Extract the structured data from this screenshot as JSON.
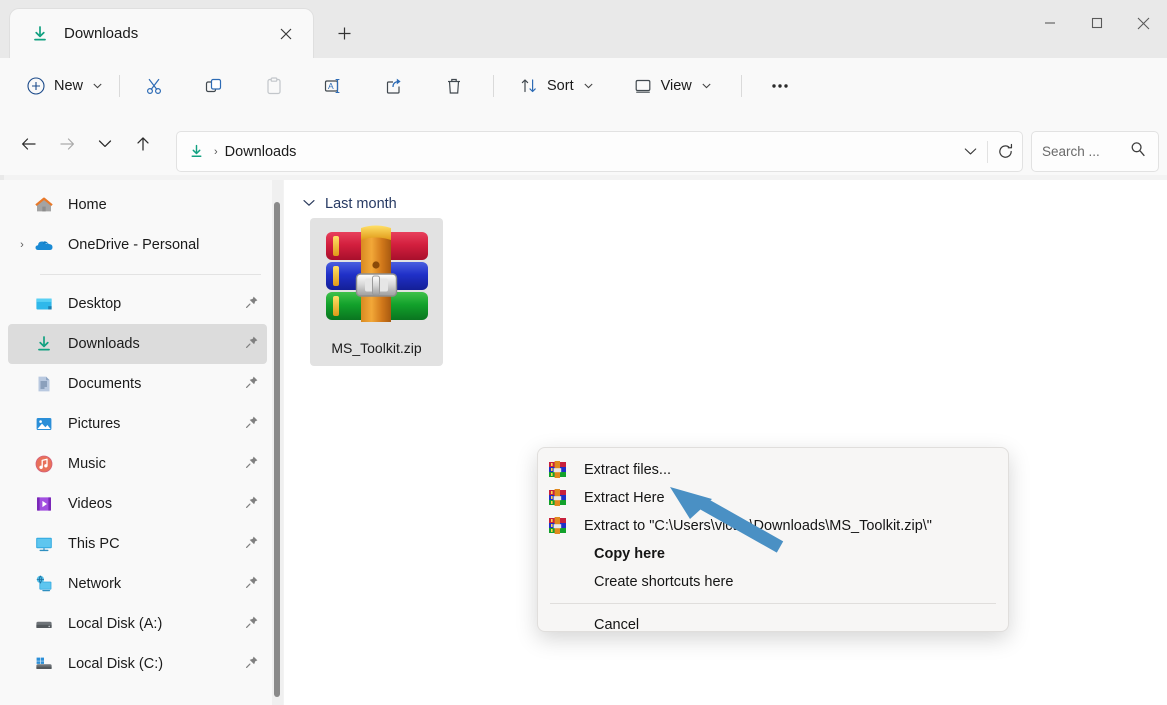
{
  "window": {
    "controls": {
      "minimize": "—",
      "maximize": "□",
      "close": "✕"
    }
  },
  "tab": {
    "title": "Downloads",
    "icon": "downloads-icon",
    "close_label": "✕",
    "new_tab_label": "+"
  },
  "toolbar": {
    "new_label": "New",
    "new_chevron": "⌄",
    "cut_label": "Cut",
    "copy_label": "Copy",
    "paste_label": "Paste",
    "rename_label": "Rename",
    "share_label": "Share",
    "delete_label": "Delete",
    "sort_label": "Sort",
    "sort_chevron": "⌄",
    "view_label": "View",
    "view_chevron": "⌄",
    "more_label": "•••"
  },
  "addressbar": {
    "back_label": "←",
    "forward_label": "→",
    "recent_label": "⌄",
    "up_label": "↑",
    "path_icon": "downloads-icon",
    "separator": "›",
    "crumb": "Downloads",
    "dropdown_label": "⌄",
    "refresh_label": "↻"
  },
  "search": {
    "placeholder": "Search ...",
    "icon": "search-icon"
  },
  "sidebar": {
    "items": [
      {
        "label": "Home",
        "icon": "home-icon",
        "expander": "",
        "pinned": false,
        "selected": false
      },
      {
        "label": "OneDrive - Personal",
        "icon": "onedrive-icon",
        "expander": "›",
        "pinned": false,
        "selected": false
      },
      {
        "label": "Desktop",
        "icon": "desktop-icon",
        "expander": "",
        "pinned": true,
        "selected": false
      },
      {
        "label": "Downloads",
        "icon": "downloads-icon",
        "expander": "",
        "pinned": true,
        "selected": true
      },
      {
        "label": "Documents",
        "icon": "documents-icon",
        "expander": "",
        "pinned": true,
        "selected": false
      },
      {
        "label": "Pictures",
        "icon": "pictures-icon",
        "expander": "",
        "pinned": true,
        "selected": false
      },
      {
        "label": "Music",
        "icon": "music-icon",
        "expander": "",
        "pinned": true,
        "selected": false
      },
      {
        "label": "Videos",
        "icon": "videos-icon",
        "expander": "",
        "pinned": true,
        "selected": false
      },
      {
        "label": "This PC",
        "icon": "thispc-icon",
        "expander": "",
        "pinned": true,
        "selected": false
      },
      {
        "label": "Network",
        "icon": "network-icon",
        "expander": "",
        "pinned": true,
        "selected": false
      },
      {
        "label": "Local Disk (A:)",
        "icon": "disk-icon",
        "expander": "",
        "pinned": true,
        "selected": false
      },
      {
        "label": "Local Disk (C:)",
        "icon": "windisk-icon",
        "expander": "",
        "pinned": true,
        "selected": false
      }
    ]
  },
  "content": {
    "group": {
      "label": "Last month",
      "chevron": "⌄"
    },
    "files": [
      {
        "name": "MS_Toolkit.zip",
        "icon": "winrar-archive-icon",
        "selected": true
      }
    ]
  },
  "context_menu": {
    "items": [
      {
        "label": "Extract files...",
        "icon": "winrar-icon",
        "bold": false,
        "has_icon": true
      },
      {
        "label": "Extract Here",
        "icon": "winrar-icon",
        "bold": false,
        "has_icon": true
      },
      {
        "label": "Extract to \"C:\\Users\\victor\\Downloads\\MS_Toolkit.zip\\\"",
        "icon": "winrar-icon",
        "bold": false,
        "has_icon": true
      },
      {
        "label": "Copy here",
        "icon": "",
        "bold": true,
        "has_icon": false
      },
      {
        "label": "Create shortcuts here",
        "icon": "",
        "bold": false,
        "has_icon": false
      }
    ],
    "cancel": {
      "label": "Cancel",
      "icon": "",
      "bold": false,
      "has_icon": false
    }
  },
  "annotation": {
    "arrow_color": "#4a90c4",
    "points_to": "Extract Here"
  },
  "colors": {
    "accent": "#0f6cbd",
    "titlebar_bg": "#e9e9e9",
    "toolbar_bg": "#f9f9f9",
    "content_bg": "#ffffff",
    "selection_bg": "#dcdcdc",
    "group_header": "#273a63",
    "menu_bg": "#f7f6f5"
  }
}
